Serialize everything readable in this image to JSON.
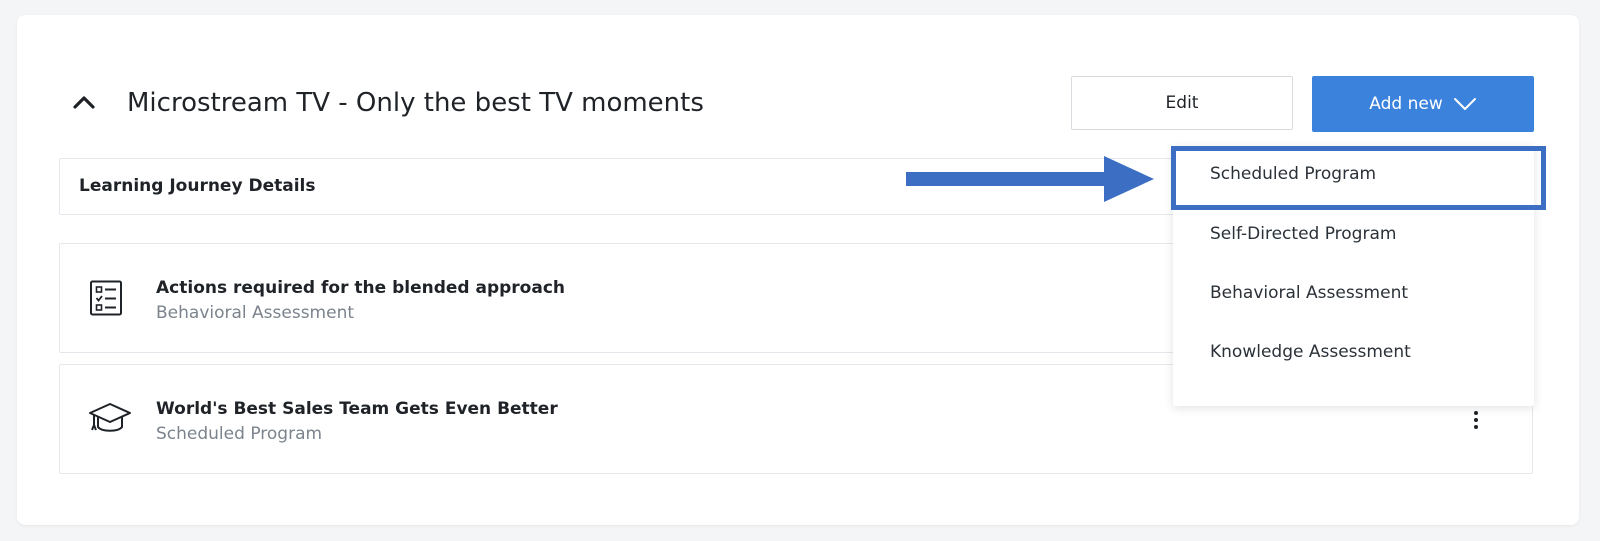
{
  "header": {
    "title": "Microstream TV - Only the best TV moments",
    "edit_label": "Edit",
    "add_new_label": "Add new"
  },
  "section": {
    "label": "Learning Journey Details"
  },
  "items": [
    {
      "title": "Actions required for the blended approach",
      "subtitle": "Behavioral Assessment",
      "icon": "checklist-icon"
    },
    {
      "title": "World's Best Sales Team Gets Even Better",
      "subtitle": "Scheduled Program",
      "icon": "graduation-cap-icon"
    }
  ],
  "dropdown": {
    "items": [
      "Scheduled Program",
      "Self-Directed Program",
      "Behavioral Assessment",
      "Knowledge Assessment"
    ],
    "highlighted_index": 0
  },
  "colors": {
    "primary": "#3b82dd",
    "annotation": "#3c6fc4",
    "muted_text": "#7b838d"
  }
}
